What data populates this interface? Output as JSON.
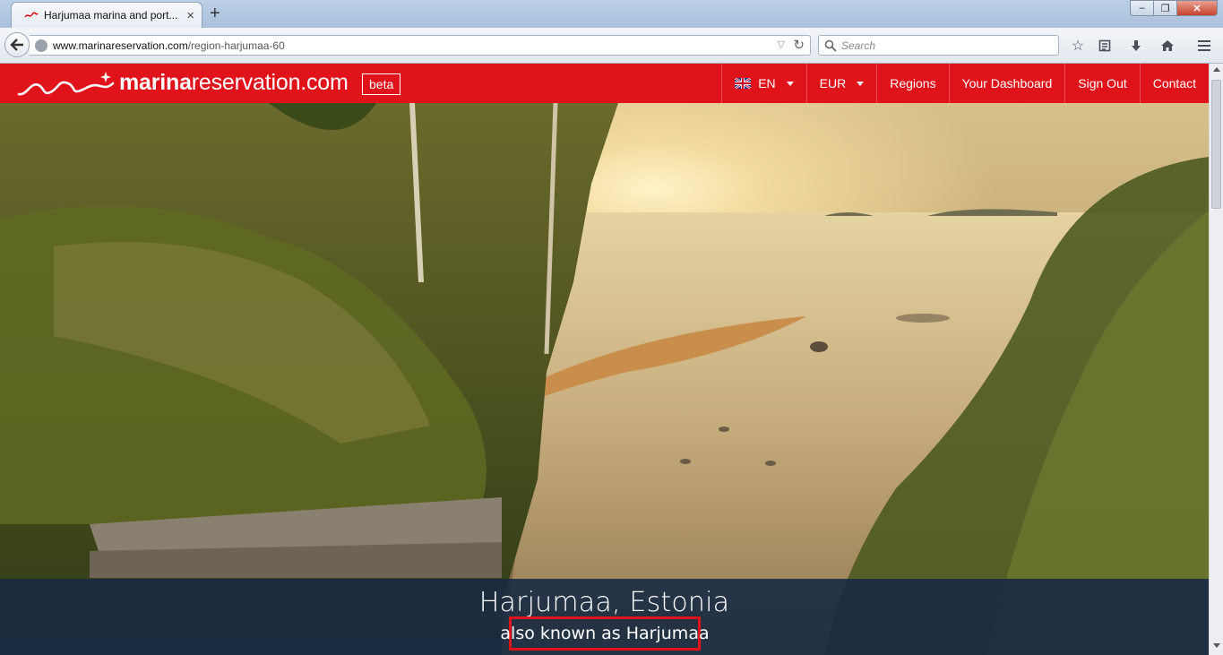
{
  "browser": {
    "tab_title": "Harjumaa marina and port...",
    "tab_close": "×",
    "new_tab": "+",
    "url_host": "www.marinareservation.com",
    "url_path": "/region-harjumaa-60",
    "search_placeholder": "Search",
    "window_controls": {
      "minimize": "–",
      "maximize": "❐",
      "close": "✕"
    }
  },
  "site": {
    "logo_bold": "marina",
    "logo_light": "reservation.com",
    "beta_label": "beta",
    "brand_color": "#e0121a",
    "nav": {
      "language": "EN",
      "currency": "EUR",
      "regions": "Regions",
      "dashboard": "Your Dashboard",
      "sign_out": "Sign Out",
      "contact": "Contact"
    }
  },
  "hero": {
    "region_title": "Harjumaa, Estonia",
    "also_known_as": "also known as Harjumaa"
  }
}
